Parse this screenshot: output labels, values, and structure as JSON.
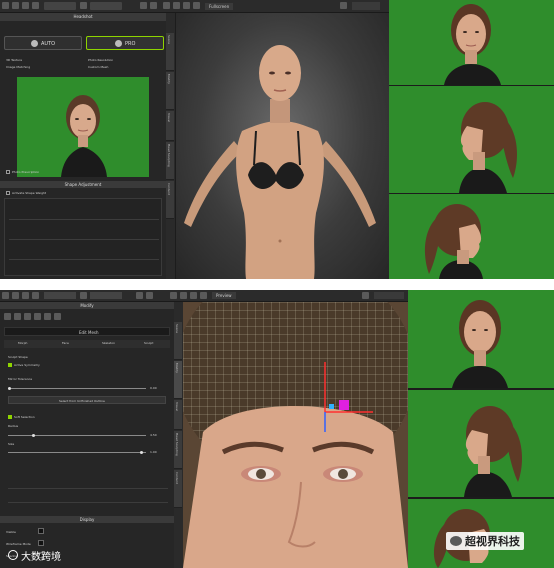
{
  "top_app": {
    "header_title": "Headshot",
    "modes": {
      "auto": "AUTO",
      "pro": "PRO"
    },
    "feature_items": [
      "3D Texture",
      "Photo Resolution",
      "Image Matching",
      "Custom Mesh"
    ],
    "feature_list_label": "Photo Prescription",
    "shape_adjustment_title": "Shape Adjustment",
    "activate_label": "Activate Shape Weight",
    "dropdown_value": "Fullscreen",
    "vertical_tabs": [
      "Scene",
      "Modify",
      "Visual",
      "Head Sculpting",
      "Content"
    ]
  },
  "bottom_app": {
    "header_title": "Modify",
    "mesh_tab_label": "Edit Mesh",
    "subtabs": [
      "Morph",
      "Face",
      "Skeleton",
      "Sculpt"
    ],
    "sculpt_section": "Sculpt Shape",
    "symmetry_label": "Active Symmetry",
    "mirror_label": "Mirror Tolerance",
    "select_btn": "Select from Unfinished Outline",
    "soft_label": "Soft Selection",
    "radius_label": "Radius",
    "radius_value": "4.50",
    "mirror_value": "0.00",
    "size_label": "Size",
    "size_value": "1.00",
    "display_section": "Display",
    "rows": [
      "Visible",
      "Wireframe Mode",
      "Shadow"
    ],
    "dropdown_value": "Preview"
  },
  "watermark_left": "大数跨境",
  "watermark_right": "超视界科技",
  "colors": {
    "accent_green": "#8ed400",
    "chroma_green": "#2f8d2c",
    "panel_bg": "#262626"
  }
}
